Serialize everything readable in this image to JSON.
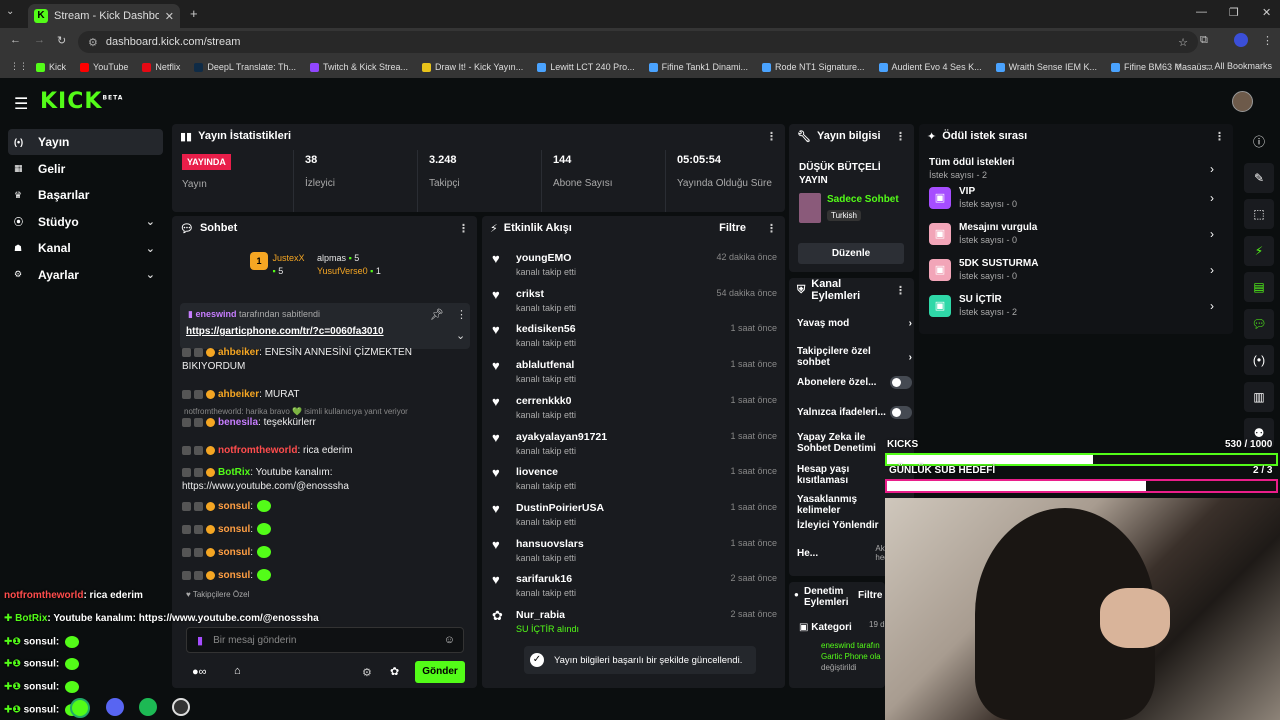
{
  "browser": {
    "tab_title": "Stream - Kick Dashboard",
    "url": "dashboard.kick.com/stream",
    "bookmarks": [
      {
        "label": "Kick",
        "color": "#53fc18"
      },
      {
        "label": "YouTube",
        "color": "#ff0000"
      },
      {
        "label": "Netflix",
        "color": "#e50914"
      },
      {
        "label": "DeepL Translate: Th...",
        "color": "#0f2b46"
      },
      {
        "label": "Twitch & Kick Strea...",
        "color": "#9146ff"
      },
      {
        "label": "Draw It! - Kick Yayın...",
        "color": "#e8c31a"
      },
      {
        "label": "Lewitt LCT 240 Pro...",
        "color": "#4aa3ff"
      },
      {
        "label": "Fifine Tank1 Dinami...",
        "color": "#4aa3ff"
      },
      {
        "label": "Rode NT1 Signature...",
        "color": "#4aa3ff"
      },
      {
        "label": "Audient Evo 4 Ses K...",
        "color": "#4aa3ff"
      },
      {
        "label": "Wraith Sense IEM K...",
        "color": "#4aa3ff"
      },
      {
        "label": "Fifine BM63 Masaüs...",
        "color": "#4aa3ff"
      }
    ],
    "all_bookmarks": "All Bookmarks"
  },
  "kick": {
    "logo": "KICK",
    "beta": "BETA"
  },
  "sidebar": [
    {
      "label": "Yayın",
      "icon": "broadcast-icon"
    },
    {
      "label": "Gelir",
      "icon": "revenue-icon"
    },
    {
      "label": "Başarılar",
      "icon": "trophy-icon"
    },
    {
      "label": "Stüdyo",
      "icon": "studio-icon"
    },
    {
      "label": "Kanal",
      "icon": "channel-icon"
    },
    {
      "label": "Ayarlar",
      "icon": "settings-icon"
    }
  ],
  "stats": {
    "title": "Yayın İstatistikleri",
    "live": "YAYINDA",
    "live_label": "Yayın",
    "items": [
      {
        "v": "38",
        "l": "İzleyici"
      },
      {
        "v": "3.248",
        "l": "Takipçi"
      },
      {
        "v": "144",
        "l": "Abone Sayısı"
      },
      {
        "v": "05:05:54",
        "l": "Yayında Olduğu Süre"
      }
    ]
  },
  "info": {
    "title": "Yayın bilgisi",
    "stream_title": "DÜŞÜK BÜTÇELİ YAYIN",
    "category": "Sadece Sohbet",
    "lang": "Turkish",
    "edit": "Düzenle"
  },
  "rewards": {
    "title": "Ödül istek sırası",
    "items": [
      {
        "n": "Tüm ödül istekleri",
        "s": "İstek sayısı - 2"
      },
      {
        "n": "VIP",
        "s": "İstek sayısı - 0",
        "color": "#a64dff"
      },
      {
        "n": "Mesajını vurgula",
        "s": "İstek sayısı - 0",
        "color": "#f2a5b8"
      },
      {
        "n": "5DK SUSTURMA",
        "s": "İstek sayısı - 0",
        "color": "#f2a5b8"
      },
      {
        "n": "SU İÇTİR",
        "s": "İstek sayısı - 2",
        "color": "#2fd8a8"
      }
    ]
  },
  "chat": {
    "title": "Sohbet",
    "top": [
      {
        "n": "JustexX",
        "c": "5"
      },
      {
        "n": "alpmas",
        "c": "5"
      },
      {
        "n": "YusufVerse0",
        "c": "1"
      }
    ],
    "pinned_by": "eneswind",
    "pinned_suffix": "tarafından sabitlendi",
    "pinned_link": "https://garticphone.com/tr/?c=0060fa3010",
    "lines": [
      {
        "u": "ahbeiker",
        "c": "#f5a623",
        "m": ": ENESİN ANNESİNİ ÇİZMEKTEN BIKIYORDUM"
      },
      {
        "u": "ahbeiker",
        "c": "#f5a623",
        "m": ": MURAT"
      },
      {
        "u": "benesila",
        "c": "#c77dff",
        "m": ": teşekkürlerr"
      },
      {
        "u": "notfromtheworld",
        "c": "#ff4d4d",
        "m": ": rica ederim"
      },
      {
        "u": "BotRix",
        "c": "#53fc18",
        "m": ": Youtube kanalım: https://www.youtube.com/@enosssha"
      },
      {
        "u": "sonsul",
        "c": "#ff9f43",
        "m": ":"
      },
      {
        "u": "sonsul",
        "c": "#ff9f43",
        "m": ":"
      },
      {
        "u": "sonsul",
        "c": "#ff9f43",
        "m": ":"
      },
      {
        "u": "sonsul",
        "c": "#ff9f43",
        "m": ":"
      }
    ],
    "reply": "notfromtheworld: harika bravo 💚 isimli kullanıcıya yanıt veriyor",
    "followers_only": "Takipçilere Özel",
    "placeholder": "Bir mesaj gönderin",
    "send": "Gönder"
  },
  "activity": {
    "title": "Etkinlik Akışı",
    "filter": "Filtre",
    "items": [
      {
        "n": "youngEMO",
        "s": "kanalı takip etti",
        "t": "42 dakika önce"
      },
      {
        "n": "crikst",
        "s": "kanalı takip etti",
        "t": "54 dakika önce"
      },
      {
        "n": "kedisiken56",
        "s": "kanalı takip etti",
        "t": "1 saat önce"
      },
      {
        "n": "ablalutfenal",
        "s": "kanalı takip etti",
        "t": "1 saat önce"
      },
      {
        "n": "cerrenkkk0",
        "s": "kanalı takip etti",
        "t": "1 saat önce"
      },
      {
        "n": "ayakyalayan91721",
        "s": "kanalı takip etti",
        "t": "1 saat önce"
      },
      {
        "n": "liovence",
        "s": "kanalı takip etti",
        "t": "1 saat önce"
      },
      {
        "n": "DustinPoirierUSA",
        "s": "kanalı takip etti",
        "t": "1 saat önce"
      },
      {
        "n": "hansuovslars",
        "s": "kanalı takip etti",
        "t": "1 saat önce"
      },
      {
        "n": "sarifaruk16",
        "s": "kanalı takip etti",
        "t": "2 saat önce"
      },
      {
        "n": "Nur_rabia",
        "s": "SU İÇTİR alındı",
        "t": "2 saat önce"
      }
    ]
  },
  "toast": "Yayın bilgileri başarılı bir şekilde güncellendi.",
  "channel_actions": {
    "title": "Kanal Eylemleri",
    "items": [
      {
        "l": "Yavaş mod",
        "r": "›"
      },
      {
        "l": "Takipçilere özel sohbet",
        "r": "›"
      },
      {
        "l": "Abonelere özel...",
        "r": "toggle"
      },
      {
        "l": "Yalnızca ifadeleri...",
        "r": "toggle"
      },
      {
        "l": "Yapay Zeka ile Sohbet Denetimi",
        "r": ""
      },
      {
        "l": "Hesap yaşı kısıtlaması",
        "r": ""
      },
      {
        "l": "Yasaklanmış kelimeler",
        "r": ""
      },
      {
        "l": "İzleyici Yönlendir",
        "r": ""
      },
      {
        "l": "He...",
        "r": "Aktif hedefler"
      }
    ]
  },
  "moderation": {
    "title": "Denetim Eylemleri",
    "filter": "Filtre",
    "category": "Kategori",
    "date": "19 d",
    "by": "eneswind tarafın",
    "game": "Gartic Phone ola",
    "changed": "değiştirildi"
  },
  "overlay": {
    "kicks_label": "KICKS",
    "kicks_value": "530 / 1000",
    "kicks_progress": 0.53,
    "sub_label": "GÜNLÜK SUB HEDEFİ",
    "sub_value": "2 / 3",
    "sub_progress": 0.667
  },
  "stream_chat": [
    {
      "u": "notfromtheworld",
      "c": "#ff4d4d",
      "m": ": rica ederim"
    },
    {
      "u": "BotRix",
      "c": "#53fc18",
      "m": ": Youtube kanalım: https://www.youtube.com/@enosssha"
    },
    {
      "u": "sonsul",
      "c": "#fff",
      "m": ":"
    },
    {
      "u": "sonsul",
      "c": "#fff",
      "m": ":"
    },
    {
      "u": "sonsul",
      "c": "#fff",
      "m": ":"
    },
    {
      "u": "sonsul",
      "c": "#fff",
      "m": ":"
    }
  ]
}
